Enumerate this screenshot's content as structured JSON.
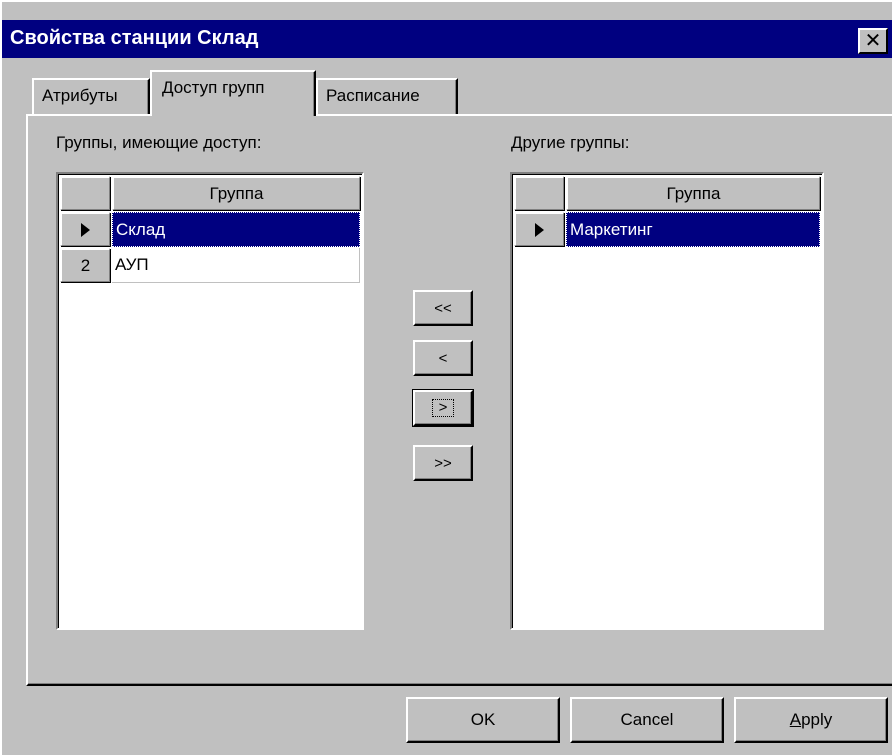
{
  "window": {
    "title": "Свойства станции Склад",
    "close_label": "✕"
  },
  "tabs": [
    {
      "label": "Атрибуты",
      "active": false
    },
    {
      "label": "Доступ групп",
      "active": true
    },
    {
      "label": "Расписание",
      "active": false
    }
  ],
  "left_panel": {
    "label": "Группы, имеющие доступ:",
    "header": "Группа",
    "rows": [
      {
        "indicator": "selected-row-arrow",
        "value": "Склад",
        "selected": true
      },
      {
        "indicator": "2",
        "value": "АУП",
        "selected": false
      }
    ]
  },
  "right_panel": {
    "label": "Другие группы:",
    "header": "Группа",
    "rows": [
      {
        "indicator": "selected-row-arrow",
        "value": "Маркетинг",
        "selected": true
      }
    ]
  },
  "transfer_buttons": {
    "all_left": "<<",
    "one_left": "<",
    "one_right": ">",
    "all_right": ">>"
  },
  "footer": {
    "ok": "OK",
    "cancel": "Cancel",
    "apply_first": "A",
    "apply_rest": "pply"
  },
  "colors": {
    "face": "#c0c0c0",
    "title_bar": "#000080",
    "selection": "#000080"
  }
}
